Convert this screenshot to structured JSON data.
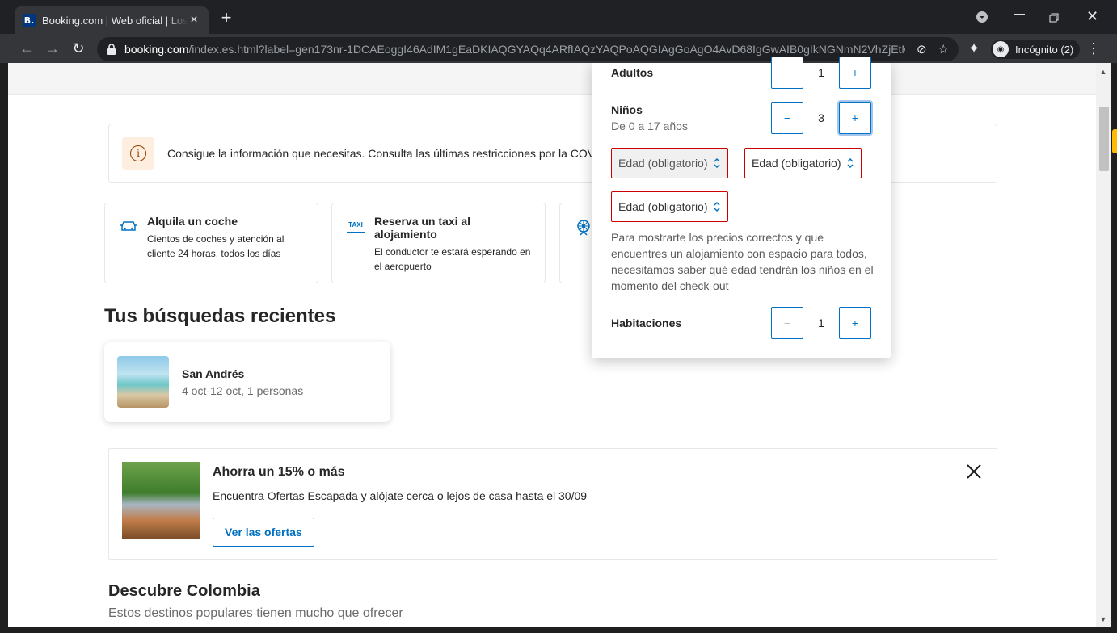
{
  "browser": {
    "tab_title": "Booking.com | Web oficial | Los m",
    "favicon_letter": "B.",
    "url_host": "booking.com",
    "url_path": "/index.es.html?label=gen173nr-1DCAEoggI46AdIM1gEaDKIAQGYAQq4ARfIAQzYAQPoAQGIAgGoAgO4AvD68IgGwAIB0gIkNGNmN2VhZjEtM...",
    "incognito_label": "Incógnito (2)"
  },
  "covid_banner": {
    "text": "Consigue la información que necesitas. Consulta las últimas restricciones por la COVID"
  },
  "cards": [
    {
      "title": "Alquila un coche",
      "desc": "Cientos de coches y atención al cliente 24 horas, todos los días",
      "icon": "car-icon"
    },
    {
      "title": "Reserva un taxi al alojamiento",
      "desc": "El conductor te estará esperando en el aeropuerto",
      "icon": "taxi-icon",
      "icon_text": "TAXI"
    },
    {
      "title": "",
      "desc": "",
      "icon": "attraction-icon"
    }
  ],
  "recent": {
    "heading": "Tus búsquedas recientes",
    "item_title": "San Andrés",
    "item_sub": "4 oct-12 oct, 1 personas"
  },
  "promo": {
    "title": "Ahorra un 15% o más",
    "desc": "Encuentra Ofertas Escapada y alójate cerca o lejos de casa hasta el 30/09",
    "button": "Ver las ofertas"
  },
  "discover": {
    "heading": "Descubre Colombia",
    "sub": "Estos destinos populares tienen mucho que ofrecer"
  },
  "occupancy": {
    "adults_label": "Adultos",
    "adults_value": "1",
    "children_label": "Niños",
    "children_sub": "De 0 a 17 años",
    "children_value": "3",
    "age_placeholder": "Edad (obligatorio)",
    "note": "Para mostrarte los precios correctos y que encuentres un alojamiento con espacio para todos, necesitamos saber qué edad tendrán los niños en el momento del check-out",
    "rooms_label": "Habitaciones",
    "rooms_value": "1",
    "minus": "−",
    "plus": "+"
  },
  "colors": {
    "brand_blue": "#0071c2",
    "error_red": "#cc0000",
    "chrome_dark": "#202124"
  }
}
